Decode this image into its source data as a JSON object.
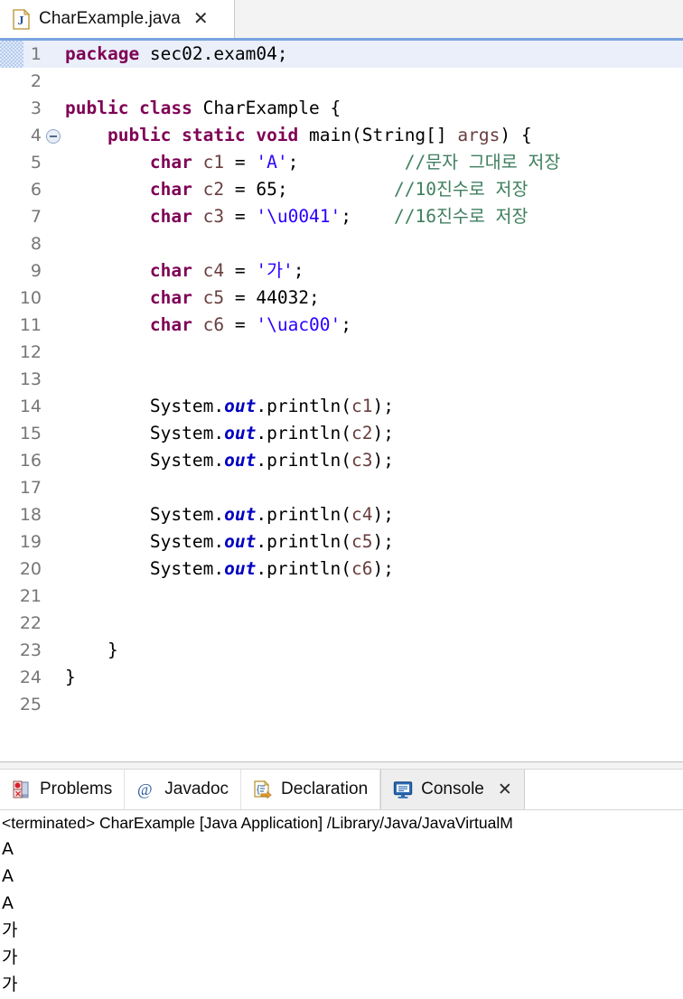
{
  "editor": {
    "tab": {
      "icon": "java-file-icon",
      "label": "CharExample.java",
      "close_label": "✕"
    },
    "current_line": 1,
    "lines": [
      {
        "n": "1",
        "fold": false,
        "marker": true,
        "current": true,
        "tokens": [
          {
            "t": "package",
            "c": "kw"
          },
          {
            "t": " sec02.exam04;",
            "c": ""
          }
        ]
      },
      {
        "n": "2",
        "fold": false,
        "marker": false,
        "current": false,
        "tokens": []
      },
      {
        "n": "3",
        "fold": false,
        "marker": false,
        "current": false,
        "tokens": [
          {
            "t": "public class",
            "c": "kw"
          },
          {
            "t": " CharExample {",
            "c": ""
          }
        ]
      },
      {
        "n": "4",
        "fold": true,
        "marker": false,
        "current": false,
        "tokens": [
          {
            "t": "    ",
            "c": ""
          },
          {
            "t": "public static void",
            "c": "kw"
          },
          {
            "t": " main(String[] ",
            "c": ""
          },
          {
            "t": "args",
            "c": "param"
          },
          {
            "t": ") {",
            "c": ""
          }
        ]
      },
      {
        "n": "5",
        "fold": false,
        "marker": false,
        "current": false,
        "tokens": [
          {
            "t": "        ",
            "c": ""
          },
          {
            "t": "char",
            "c": "kw"
          },
          {
            "t": " ",
            "c": ""
          },
          {
            "t": "c1",
            "c": "param"
          },
          {
            "t": " = ",
            "c": ""
          },
          {
            "t": "'A'",
            "c": "str"
          },
          {
            "t": ";",
            "c": ""
          },
          {
            "t": "          ",
            "c": ""
          },
          {
            "t": "//문자 그대로 저장",
            "c": "cmt"
          }
        ]
      },
      {
        "n": "6",
        "fold": false,
        "marker": false,
        "current": false,
        "tokens": [
          {
            "t": "        ",
            "c": ""
          },
          {
            "t": "char",
            "c": "kw"
          },
          {
            "t": " ",
            "c": ""
          },
          {
            "t": "c2",
            "c": "param"
          },
          {
            "t": " = 65;",
            "c": ""
          },
          {
            "t": "          ",
            "c": ""
          },
          {
            "t": "//10진수로 저장",
            "c": "cmt"
          }
        ]
      },
      {
        "n": "7",
        "fold": false,
        "marker": false,
        "current": false,
        "tokens": [
          {
            "t": "        ",
            "c": ""
          },
          {
            "t": "char",
            "c": "kw"
          },
          {
            "t": " ",
            "c": ""
          },
          {
            "t": "c3",
            "c": "param"
          },
          {
            "t": " = ",
            "c": ""
          },
          {
            "t": "'\\u0041'",
            "c": "str"
          },
          {
            "t": ";",
            "c": ""
          },
          {
            "t": "    ",
            "c": ""
          },
          {
            "t": "//16진수로 저장",
            "c": "cmt"
          }
        ]
      },
      {
        "n": "8",
        "fold": false,
        "marker": false,
        "current": false,
        "tokens": []
      },
      {
        "n": "9",
        "fold": false,
        "marker": false,
        "current": false,
        "tokens": [
          {
            "t": "        ",
            "c": ""
          },
          {
            "t": "char",
            "c": "kw"
          },
          {
            "t": " ",
            "c": ""
          },
          {
            "t": "c4",
            "c": "param"
          },
          {
            "t": " = ",
            "c": ""
          },
          {
            "t": "'가'",
            "c": "str"
          },
          {
            "t": ";",
            "c": ""
          }
        ]
      },
      {
        "n": "10",
        "fold": false,
        "marker": false,
        "current": false,
        "tokens": [
          {
            "t": "        ",
            "c": ""
          },
          {
            "t": "char",
            "c": "kw"
          },
          {
            "t": " ",
            "c": ""
          },
          {
            "t": "c5",
            "c": "param"
          },
          {
            "t": " = 44032;",
            "c": ""
          }
        ]
      },
      {
        "n": "11",
        "fold": false,
        "marker": false,
        "current": false,
        "tokens": [
          {
            "t": "        ",
            "c": ""
          },
          {
            "t": "char",
            "c": "kw"
          },
          {
            "t": " ",
            "c": ""
          },
          {
            "t": "c6",
            "c": "param"
          },
          {
            "t": " = ",
            "c": ""
          },
          {
            "t": "'\\uac00'",
            "c": "str"
          },
          {
            "t": ";",
            "c": ""
          }
        ]
      },
      {
        "n": "12",
        "fold": false,
        "marker": false,
        "current": false,
        "tokens": []
      },
      {
        "n": "13",
        "fold": false,
        "marker": false,
        "current": false,
        "tokens": []
      },
      {
        "n": "14",
        "fold": false,
        "marker": false,
        "current": false,
        "tokens": [
          {
            "t": "        System.",
            "c": ""
          },
          {
            "t": "out",
            "c": "fld"
          },
          {
            "t": ".println(",
            "c": ""
          },
          {
            "t": "c1",
            "c": "param"
          },
          {
            "t": ");",
            "c": ""
          }
        ]
      },
      {
        "n": "15",
        "fold": false,
        "marker": false,
        "current": false,
        "tokens": [
          {
            "t": "        System.",
            "c": ""
          },
          {
            "t": "out",
            "c": "fld"
          },
          {
            "t": ".println(",
            "c": ""
          },
          {
            "t": "c2",
            "c": "param"
          },
          {
            "t": ");",
            "c": ""
          }
        ]
      },
      {
        "n": "16",
        "fold": false,
        "marker": false,
        "current": false,
        "tokens": [
          {
            "t": "        System.",
            "c": ""
          },
          {
            "t": "out",
            "c": "fld"
          },
          {
            "t": ".println(",
            "c": ""
          },
          {
            "t": "c3",
            "c": "param"
          },
          {
            "t": ");",
            "c": ""
          }
        ]
      },
      {
        "n": "17",
        "fold": false,
        "marker": false,
        "current": false,
        "tokens": []
      },
      {
        "n": "18",
        "fold": false,
        "marker": false,
        "current": false,
        "tokens": [
          {
            "t": "        System.",
            "c": ""
          },
          {
            "t": "out",
            "c": "fld"
          },
          {
            "t": ".println(",
            "c": ""
          },
          {
            "t": "c4",
            "c": "param"
          },
          {
            "t": ");",
            "c": ""
          }
        ]
      },
      {
        "n": "19",
        "fold": false,
        "marker": false,
        "current": false,
        "tokens": [
          {
            "t": "        System.",
            "c": ""
          },
          {
            "t": "out",
            "c": "fld"
          },
          {
            "t": ".println(",
            "c": ""
          },
          {
            "t": "c5",
            "c": "param"
          },
          {
            "t": ");",
            "c": ""
          }
        ]
      },
      {
        "n": "20",
        "fold": false,
        "marker": false,
        "current": false,
        "tokens": [
          {
            "t": "        System.",
            "c": ""
          },
          {
            "t": "out",
            "c": "fld"
          },
          {
            "t": ".println(",
            "c": ""
          },
          {
            "t": "c6",
            "c": "param"
          },
          {
            "t": ");",
            "c": ""
          }
        ]
      },
      {
        "n": "21",
        "fold": false,
        "marker": false,
        "current": false,
        "tokens": []
      },
      {
        "n": "22",
        "fold": false,
        "marker": false,
        "current": false,
        "tokens": []
      },
      {
        "n": "23",
        "fold": false,
        "marker": false,
        "current": false,
        "tokens": [
          {
            "t": "    }",
            "c": ""
          }
        ]
      },
      {
        "n": "24",
        "fold": false,
        "marker": false,
        "current": false,
        "tokens": [
          {
            "t": "}",
            "c": ""
          }
        ]
      },
      {
        "n": "25",
        "fold": false,
        "marker": false,
        "current": false,
        "tokens": []
      }
    ]
  },
  "bottom_panel": {
    "tabs": [
      {
        "id": "problems",
        "icon": "problems-icon",
        "label": "Problems",
        "active": false,
        "closable": false
      },
      {
        "id": "javadoc",
        "icon": "javadoc-icon",
        "label": "Javadoc",
        "active": false,
        "closable": false
      },
      {
        "id": "declaration",
        "icon": "declaration-icon",
        "label": "Declaration",
        "active": false,
        "closable": false
      },
      {
        "id": "console",
        "icon": "console-icon",
        "label": "Console",
        "active": true,
        "closable": true
      }
    ],
    "close_label": "✕",
    "status_line": "<terminated> CharExample [Java Application] /Library/Java/JavaVirtualM",
    "output_lines": [
      "A",
      "A",
      "A",
      "가",
      "가",
      "가"
    ]
  },
  "colors": {
    "keyword": "#7f0055",
    "string": "#2a00ff",
    "comment": "#3f7f5f",
    "field": "#0000c0",
    "parameter": "#6a3e3e",
    "tab_underline": "#7aa3e0",
    "current_line_bg": "#eaeffa"
  }
}
